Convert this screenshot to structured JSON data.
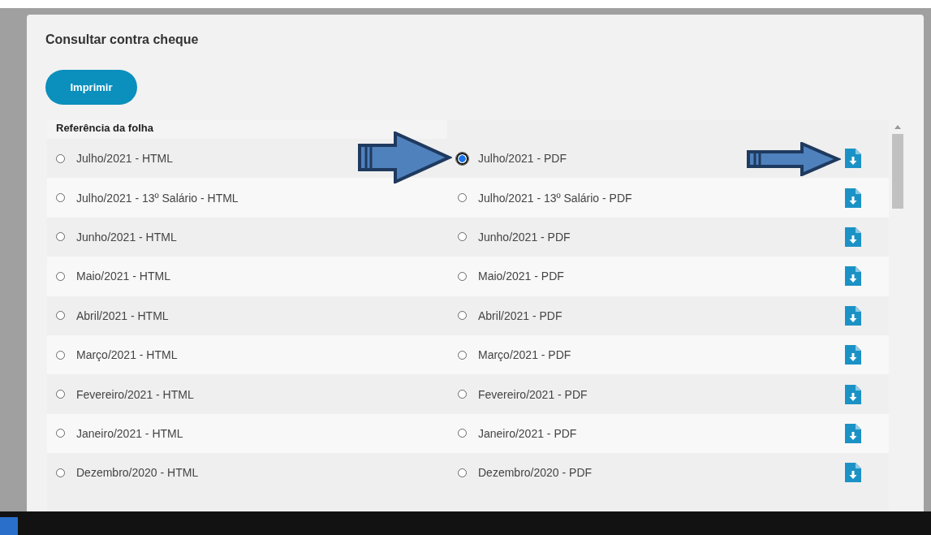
{
  "title": "Consultar contra cheque",
  "print_button": "Imprimir",
  "table": {
    "header": "Referência da folha",
    "rows": [
      {
        "html": {
          "label": "Julho/2021 - HTML",
          "selected": false
        },
        "pdf": {
          "label": "Julho/2021 - PDF",
          "selected": true
        }
      },
      {
        "html": {
          "label": "Julho/2021 - 13º Salário - HTML",
          "selected": false
        },
        "pdf": {
          "label": "Julho/2021 - 13º Salário - PDF",
          "selected": false
        }
      },
      {
        "html": {
          "label": "Junho/2021 - HTML",
          "selected": false
        },
        "pdf": {
          "label": "Junho/2021 - PDF",
          "selected": false
        }
      },
      {
        "html": {
          "label": "Maio/2021 - HTML",
          "selected": false
        },
        "pdf": {
          "label": "Maio/2021 - PDF",
          "selected": false
        }
      },
      {
        "html": {
          "label": "Abril/2021 - HTML",
          "selected": false
        },
        "pdf": {
          "label": "Abril/2021 - PDF",
          "selected": false
        }
      },
      {
        "html": {
          "label": "Março/2021 - HTML",
          "selected": false
        },
        "pdf": {
          "label": "Março/2021 - PDF",
          "selected": false
        }
      },
      {
        "html": {
          "label": "Fevereiro/2021 - HTML",
          "selected": false
        },
        "pdf": {
          "label": "Fevereiro/2021 - PDF",
          "selected": false
        }
      },
      {
        "html": {
          "label": "Janeiro/2021 - HTML",
          "selected": false
        },
        "pdf": {
          "label": "Janeiro/2021 - PDF",
          "selected": false
        }
      },
      {
        "html": {
          "label": "Dezembro/2020 - HTML",
          "selected": false
        },
        "pdf": {
          "label": "Dezembro/2020 - PDF",
          "selected": false
        }
      }
    ]
  }
}
